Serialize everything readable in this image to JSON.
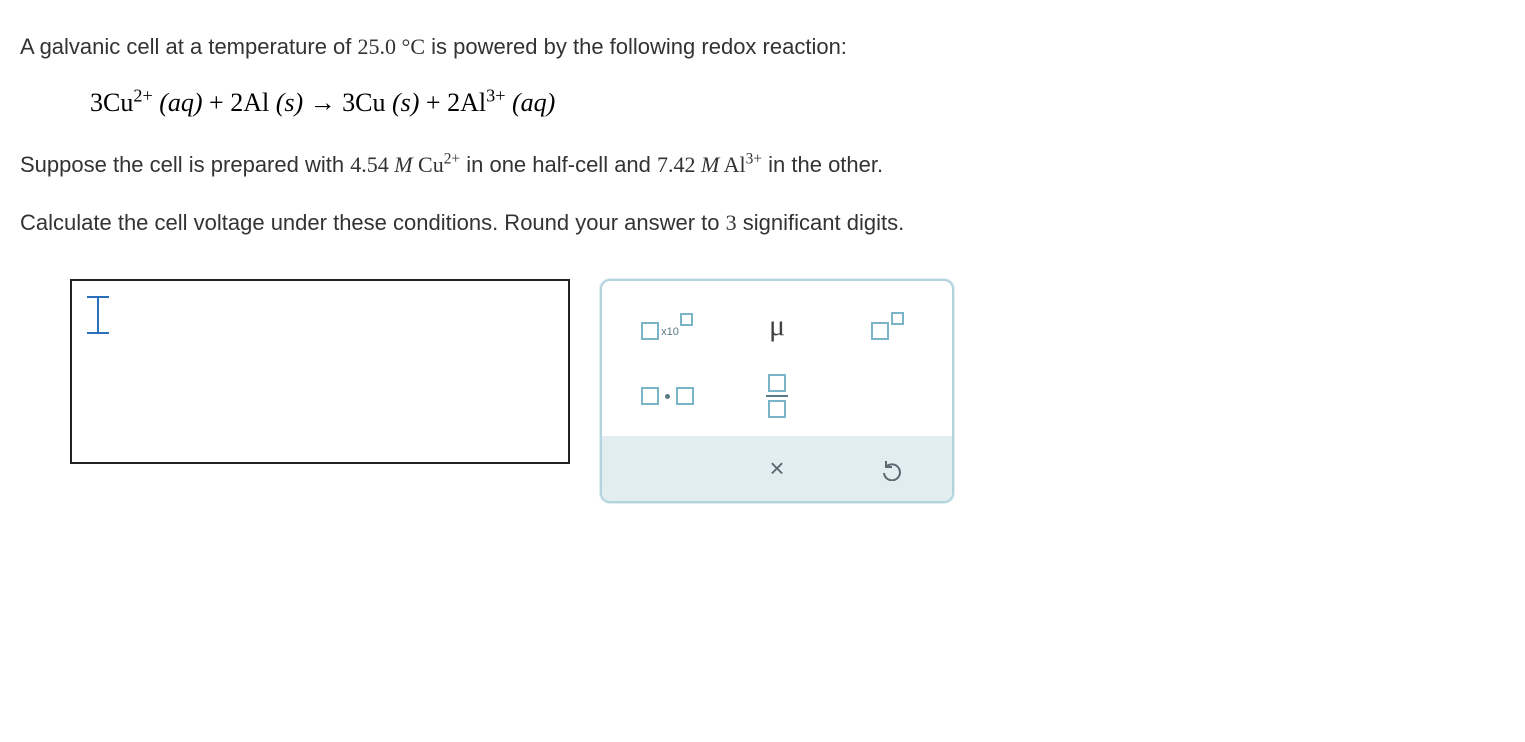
{
  "problem": {
    "intro_prefix": "A galvanic cell at a temperature of ",
    "temperature": "25.0 °C",
    "intro_suffix": " is powered by the following redox reaction:",
    "equation": {
      "part1": "3Cu",
      "sup1": "2+",
      "state1": " (aq)",
      "plus1": "+",
      "part2": "2Al",
      "state2": " (s)",
      "arrow": " → ",
      "part3": "3Cu",
      "state3": " (s)",
      "plus2": "+",
      "part4": "2Al",
      "sup2": "3+",
      "state4": " (aq)"
    },
    "p2_pre": "Suppose the cell is prepared with ",
    "conc1_val": "4.54 ",
    "conc1_unit": "M",
    "conc1_species": " Cu",
    "conc1_charge": "2+",
    "p2_mid": " in one half-cell and ",
    "conc2_val": "7.42 ",
    "conc2_unit": "M",
    "conc2_species": " Al",
    "conc2_charge": "3+",
    "p2_post": " in the other.",
    "instruction_pre": "Calculate the cell voltage under these conditions. Round your answer to ",
    "sig_digits": "3",
    "instruction_post": " significant digits."
  },
  "answer": {
    "value": ""
  },
  "calcpad": {
    "scientific_label": "x10",
    "mu_label": "μ",
    "clear_label": "×",
    "undo_label": "undo"
  }
}
